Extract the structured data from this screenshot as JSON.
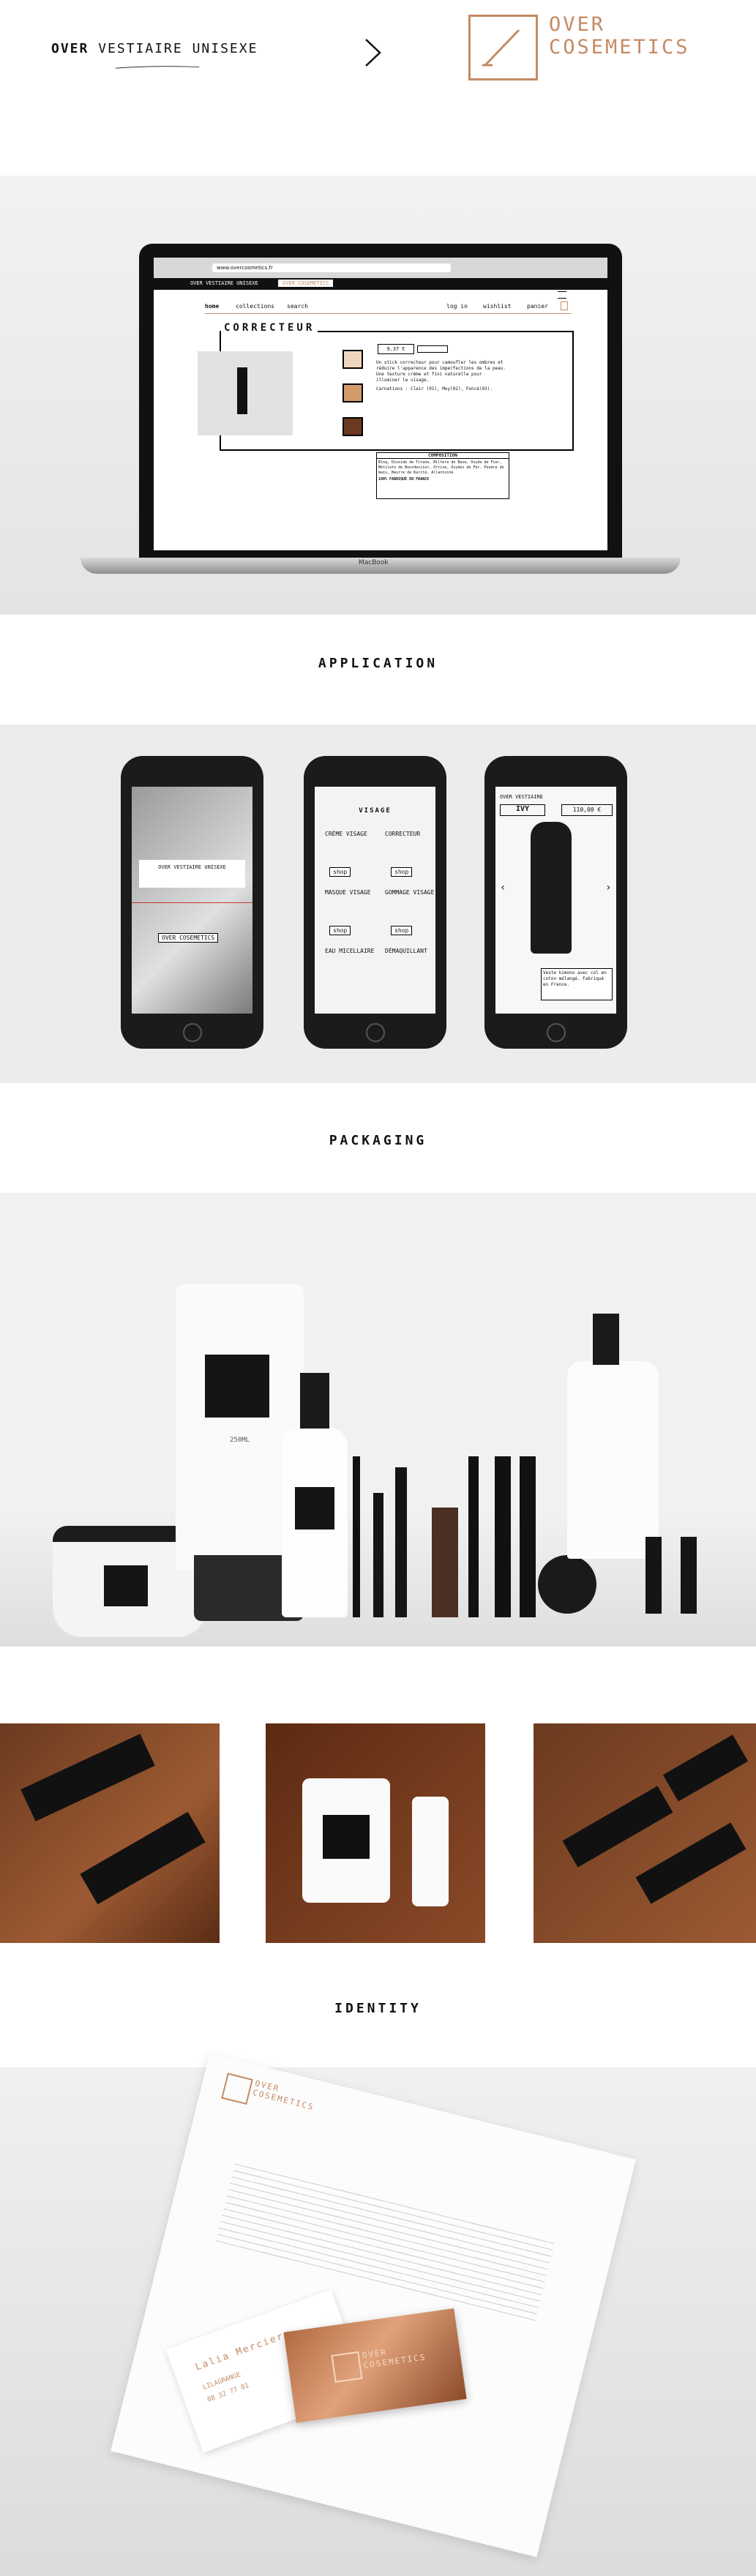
{
  "header": {
    "brand_prefix": "OVER",
    "brand_rest": "VESTIAIRE UNISEXE",
    "logo_line1": "OVER",
    "logo_line2": "COSEMETICS"
  },
  "browser": {
    "url": "www.overcosmetics.fr"
  },
  "site": {
    "tab_vestiaire": "OVER VESTIAIRE UNISEXE",
    "tab_cosmetics": "OVER COSEMETICS",
    "nav_home": "home",
    "nav_collections": "collections",
    "nav_search": "search",
    "nav_login": "log in",
    "nav_wishlist": "wishlist",
    "nav_panier": "panier",
    "product_title": "CORRECTEUR",
    "price": "9.37 €",
    "description": "Un stick correcteur pour camoufler les ombres et réduire l'apparence des imperfections de la peau. Une texture crème et fini naturelle pour illuminer le visage.",
    "shades": "Carnations : Clair (01), Moy(02), Foncé(03).",
    "composition_heading": "COMPOSITION",
    "composition_text": "Bloq, Dioxide de Titane, Miltere de Base, Oxyde de Fier, Métilate de Bourdescier, Ortive, Oxydes de Fer. Poudre de maïs, Beurre de Karité, Allantoïne",
    "made_in": "100% FABRIQUÉ EN FRANCE",
    "laptop_brand": "MacBook"
  },
  "sections": {
    "application": "APPLICATION",
    "packaging": "PACKAGING",
    "identity": "IDENTITY"
  },
  "phones": {
    "p1_label": "OVER VESTIAIRE UNISEXE",
    "p1_button": "OVER COSEMETICS",
    "p2_header": "VISAGE",
    "p2_items": [
      "CRÈME VISAGE",
      "CORRECTEUR",
      "MASQUE VISAGE",
      "GOMMAGE VISAGE",
      "EAU MICELLAIRE",
      "DÉMAQUILLANT"
    ],
    "p2_button": "shop",
    "p3_brand": "OVER VESTIAIRE",
    "p3_title": "IVY",
    "p3_price": "110,00 €",
    "p3_caption": "Veste kimono avec col en coton mélangé. Fabriqué en France."
  },
  "packaging_labels": {
    "tube_volume": "250ML"
  },
  "letter": {
    "brand1": "OVER",
    "brand2": "COSEMETICS",
    "card_name": "Lalia Mercier",
    "card_line1": "LILAGRANGE",
    "card_line2": "08 32 77 01"
  },
  "colors": {
    "accent": "#c58a63",
    "section_grey": "#ececec"
  }
}
